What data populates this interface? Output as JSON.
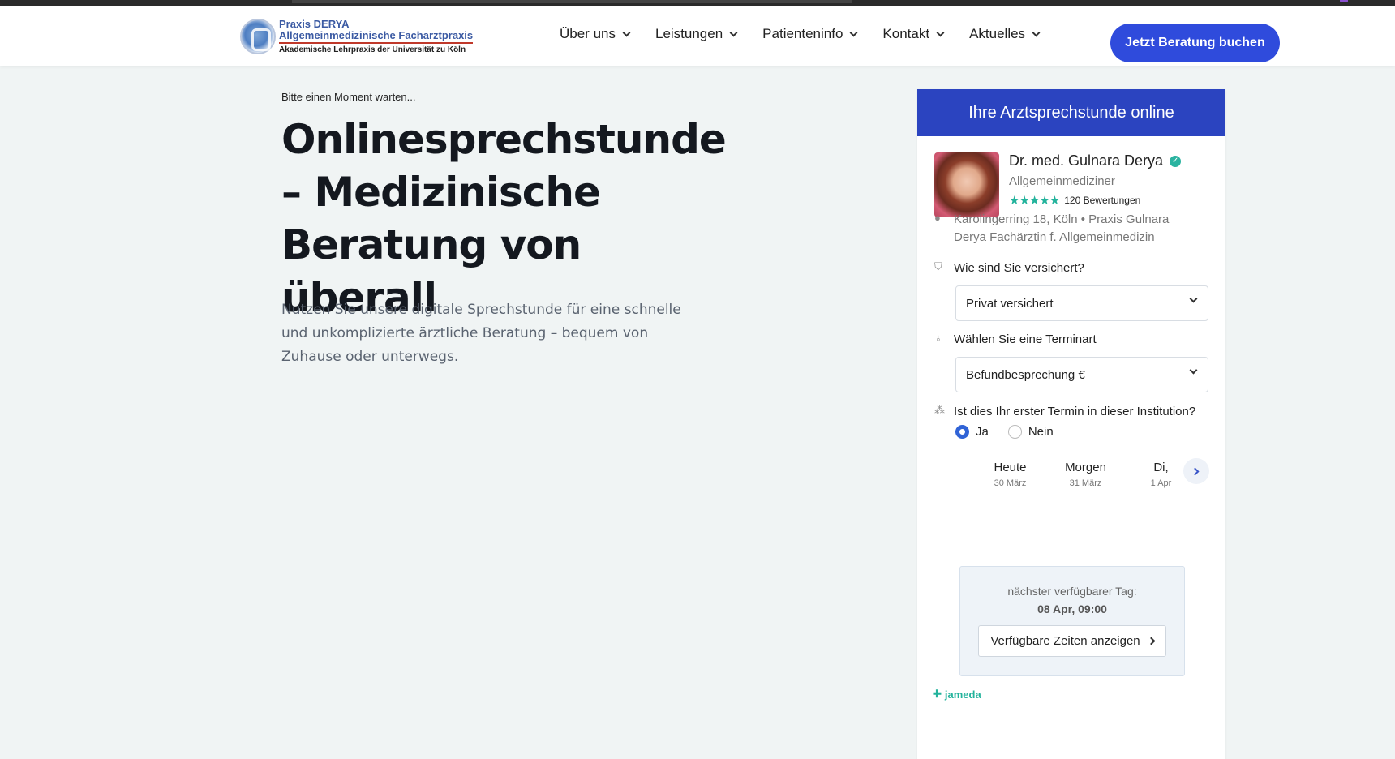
{
  "logo": {
    "line1": "Praxis DERYA",
    "line2": "Allgemeinmedizinische Facharztpraxis",
    "line3": "Akademische Lehrpraxis der Universität zu Köln"
  },
  "nav": [
    {
      "label": "Über uns"
    },
    {
      "label": "Leistungen"
    },
    {
      "label": "Patienteninfo"
    },
    {
      "label": "Kontakt"
    },
    {
      "label": "Aktuelles"
    }
  ],
  "cta_label": "Jetzt Beratung buchen",
  "hero": {
    "wait_text": "Bitte einen Moment warten...",
    "title": "Onlinesprechstunde – Medizinische Beratung von überall",
    "intro": "Nutzen Sie unsere digitale Sprechstunde für eine schnelle und unkomplizierte ärztliche Beratung – bequem von Zuhause oder unterwegs."
  },
  "widget": {
    "header": "Ihre Arztsprechstunde online",
    "doctor": {
      "name": "Dr. med. Gulnara Derya",
      "specialty": "Allgemeinmediziner",
      "stars": "★★★★★",
      "reviews": "120 Bewertungen"
    },
    "address": "Karolingerring 18, Köln  •  Praxis Gulnara Derya Fachärztin f. Allgemeinmedizin",
    "insurance_label": "Wie sind Sie versichert?",
    "insurance_value": "Privat versichert",
    "appointment_label": "Wählen Sie eine Terminart",
    "appointment_value": "Befundbesprechung €",
    "first_visit_label": "Ist dies Ihr erster Termin in dieser Institution?",
    "yes_label": "Ja",
    "no_label": "Nein",
    "days": [
      {
        "name": "Heute",
        "date": "30 März"
      },
      {
        "name": "Morgen",
        "date": "31 März"
      },
      {
        "name": "Di,",
        "date": "1 Apr"
      }
    ],
    "next_available_label": "nächster verfügbarer Tag:",
    "next_available_value": "08 Apr, 09:00",
    "show_times_label": "Verfügbare Zeiten anzeigen",
    "brand": "jameda"
  },
  "colors": {
    "primary": "#2f4bdc",
    "widget_header": "#2b44c0",
    "rating": "#23b39c",
    "background": "#f0f4f4"
  }
}
